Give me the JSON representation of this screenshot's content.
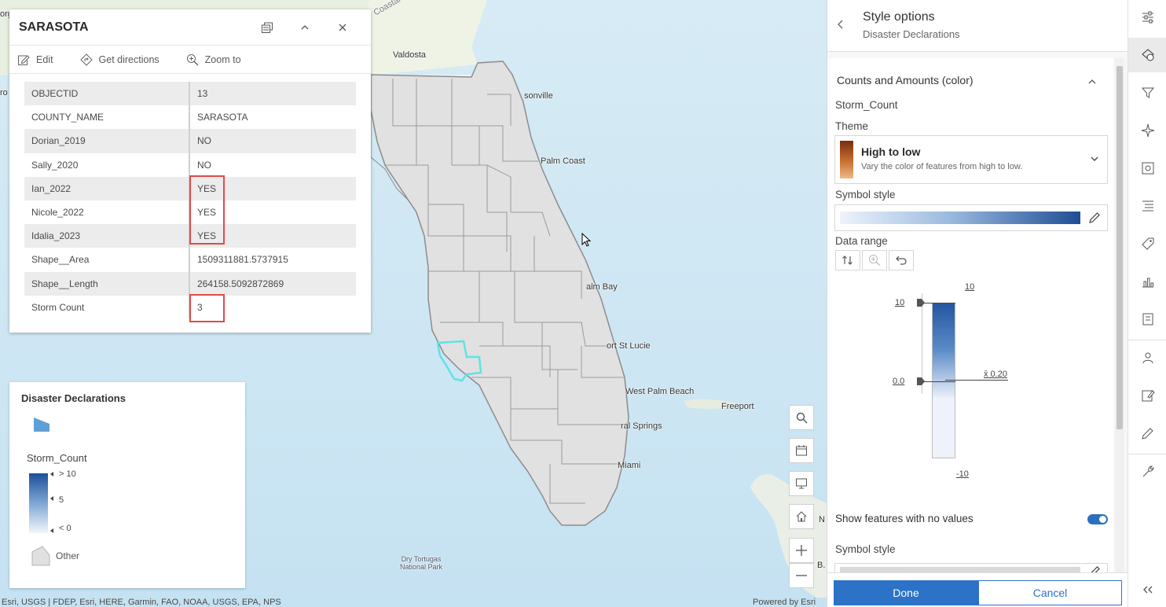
{
  "popup": {
    "title": "SARASOTA",
    "actions": {
      "edit": "Edit",
      "directions": "Get directions",
      "zoom": "Zoom to"
    },
    "rows": [
      {
        "key": "OBJECTID",
        "value": "13"
      },
      {
        "key": "COUNTY_NAME",
        "value": "SARASOTA"
      },
      {
        "key": "Dorian_2019",
        "value": "NO"
      },
      {
        "key": "Sally_2020",
        "value": "NO"
      },
      {
        "key": "Ian_2022",
        "value": "YES"
      },
      {
        "key": "Nicole_2022",
        "value": "YES"
      },
      {
        "key": "Idalia_2023",
        "value": "YES"
      },
      {
        "key": "Shape__Area",
        "value": "1509311881.5737915"
      },
      {
        "key": "Shape__Length",
        "value": "264158.5092872869"
      },
      {
        "key": "Storm Count",
        "value": "3"
      }
    ]
  },
  "legend": {
    "title": "Disaster Declarations",
    "field": "Storm_Count",
    "ticks": [
      "> 10",
      "5",
      "< 0"
    ],
    "other": "Other"
  },
  "map": {
    "labels": {
      "valdosta": "Valdosta",
      "jacksonville": "sonville",
      "palm_coast": "Palm Coast",
      "palm_bay": "alm Bay",
      "port_st_lucie": "ort St Lucie",
      "west_palm_beach": "West Palm Beach",
      "coral_springs": "ral Springs",
      "miami": "Miami",
      "freeport": "Freeport",
      "dry_tortugas": "Dry Tortugas National Park",
      "coastal": "Coastal",
      "edge_org": "org",
      "edge_ro": "ro",
      "edge_n": "N",
      "edge_b": "B."
    },
    "attribution": "Esri, USGS | FDEP, Esri, HERE, Garmin, FAO, NOAA, USGS, EPA, NPS",
    "powered_by": "Powered by Esri",
    "selected_county_color": "#5fe3e3"
  },
  "panel": {
    "title": "Style options",
    "subtitle": "Disaster Declarations",
    "section_title": "Counts and Amounts (color)",
    "field": "Storm_Count",
    "theme_label": "Theme",
    "theme_name": "High to low",
    "theme_desc": "Vary the color of features from high to low.",
    "symbol_style_label": "Symbol style",
    "data_range_label": "Data range",
    "range_top": "10",
    "range_bottom": "-10",
    "handle_high": "10",
    "handle_low": "0.0",
    "mean_label": "x̄ 0.20",
    "show_no_values_label": "Show features with no values",
    "show_no_values": true,
    "symbol_style_label_2": "Symbol style",
    "done": "Done",
    "cancel": "Cancel",
    "accent_color": "#2c72c7"
  }
}
